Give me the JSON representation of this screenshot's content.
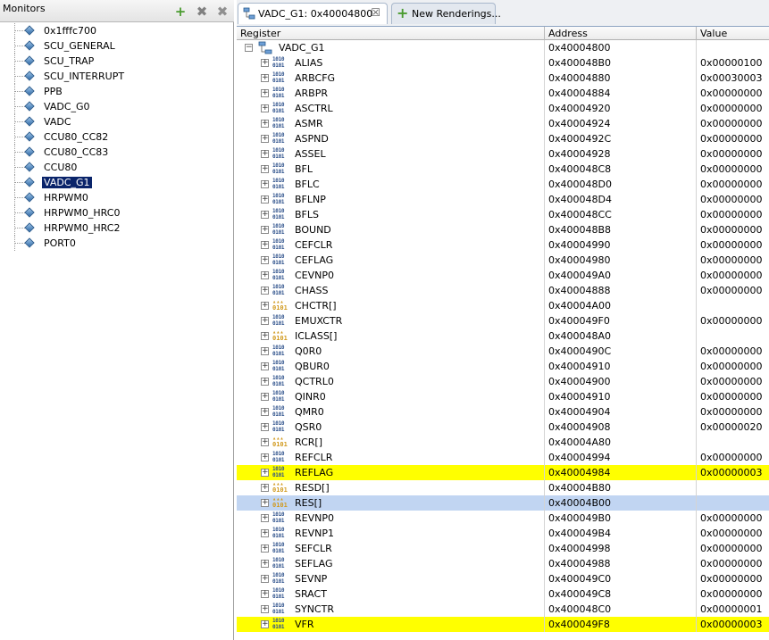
{
  "monitors": {
    "title": "Monitors",
    "add_label": "+",
    "remove_label": "✖",
    "remove_all_label": "✖",
    "items": [
      {
        "label": "0x1fffc700"
      },
      {
        "label": "SCU_GENERAL"
      },
      {
        "label": "SCU_TRAP"
      },
      {
        "label": "SCU_INTERRUPT"
      },
      {
        "label": "PPB"
      },
      {
        "label": "VADC_G0"
      },
      {
        "label": "VADC"
      },
      {
        "label": "CCU80_CC82"
      },
      {
        "label": "CCU80_CC83"
      },
      {
        "label": "CCU80"
      },
      {
        "label": "VADC_G1",
        "selected": true
      },
      {
        "label": "HRPWM0"
      },
      {
        "label": "HRPWM0_HRC0"
      },
      {
        "label": "HRPWM0_HRC2"
      },
      {
        "label": "PORT0"
      }
    ]
  },
  "tabs": [
    {
      "label": "VADC_G1: 0x40004800",
      "close": "☒"
    },
    {
      "label": "New Renderings...",
      "plus": "+"
    }
  ],
  "table": {
    "headers": {
      "register": "Register",
      "address": "Address",
      "value": "Value"
    },
    "root": {
      "name": "VADC_G1",
      "address": "0x40004800",
      "expander": "−"
    },
    "rows": [
      {
        "name": "ALIAS",
        "address": "0x400048B0",
        "value": "0x00000100",
        "icon": "reg"
      },
      {
        "name": "ARBCFG",
        "address": "0x40004880",
        "value": "0x00030003",
        "icon": "reg"
      },
      {
        "name": "ARBPR",
        "address": "0x40004884",
        "value": "0x00000000",
        "icon": "reg"
      },
      {
        "name": "ASCTRL",
        "address": "0x40004920",
        "value": "0x00000000",
        "icon": "reg"
      },
      {
        "name": "ASMR",
        "address": "0x40004924",
        "value": "0x00000000",
        "icon": "reg"
      },
      {
        "name": "ASPND",
        "address": "0x4000492C",
        "value": "0x00000000",
        "icon": "reg"
      },
      {
        "name": "ASSEL",
        "address": "0x40004928",
        "value": "0x00000000",
        "icon": "reg"
      },
      {
        "name": "BFL",
        "address": "0x400048C8",
        "value": "0x00000000",
        "icon": "reg"
      },
      {
        "name": "BFLC",
        "address": "0x400048D0",
        "value": "0x00000000",
        "icon": "reg"
      },
      {
        "name": "BFLNP",
        "address": "0x400048D4",
        "value": "0x00000000",
        "icon": "reg"
      },
      {
        "name": "BFLS",
        "address": "0x400048CC",
        "value": "0x00000000",
        "icon": "reg"
      },
      {
        "name": "BOUND",
        "address": "0x400048B8",
        "value": "0x00000000",
        "icon": "reg"
      },
      {
        "name": "CEFCLR",
        "address": "0x40004990",
        "value": "0x00000000",
        "icon": "reg"
      },
      {
        "name": "CEFLAG",
        "address": "0x40004980",
        "value": "0x00000000",
        "icon": "reg"
      },
      {
        "name": "CEVNP0",
        "address": "0x400049A0",
        "value": "0x00000000",
        "icon": "reg"
      },
      {
        "name": "CHASS",
        "address": "0x40004888",
        "value": "0x00000000",
        "icon": "reg"
      },
      {
        "name": "CHCTR[]",
        "address": "0x40004A00",
        "value": "",
        "icon": "arr"
      },
      {
        "name": "EMUXCTR",
        "address": "0x400049F0",
        "value": "0x00000000",
        "icon": "reg"
      },
      {
        "name": "ICLASS[]",
        "address": "0x400048A0",
        "value": "",
        "icon": "arr"
      },
      {
        "name": "Q0R0",
        "address": "0x4000490C",
        "value": "0x00000000",
        "icon": "reg"
      },
      {
        "name": "QBUR0",
        "address": "0x40004910",
        "value": "0x00000000",
        "icon": "reg"
      },
      {
        "name": "QCTRL0",
        "address": "0x40004900",
        "value": "0x00000000",
        "icon": "reg"
      },
      {
        "name": "QINR0",
        "address": "0x40004910",
        "value": "0x00000000",
        "icon": "reg"
      },
      {
        "name": "QMR0",
        "address": "0x40004904",
        "value": "0x00000000",
        "icon": "reg"
      },
      {
        "name": "QSR0",
        "address": "0x40004908",
        "value": "0x00000020",
        "icon": "reg"
      },
      {
        "name": "RCR[]",
        "address": "0x40004A80",
        "value": "",
        "icon": "arr"
      },
      {
        "name": "REFCLR",
        "address": "0x40004994",
        "value": "0x00000000",
        "icon": "reg"
      },
      {
        "name": "REFLAG",
        "address": "0x40004984",
        "value": "0x00000003",
        "icon": "reg",
        "highlight": "yellow"
      },
      {
        "name": "RESD[]",
        "address": "0x40004B80",
        "value": "",
        "icon": "arr"
      },
      {
        "name": "RES[]",
        "address": "0x40004B00",
        "value": "",
        "icon": "arr",
        "highlight": "selected"
      },
      {
        "name": "REVNP0",
        "address": "0x400049B0",
        "value": "0x00000000",
        "icon": "reg"
      },
      {
        "name": "REVNP1",
        "address": "0x400049B4",
        "value": "0x00000000",
        "icon": "reg"
      },
      {
        "name": "SEFCLR",
        "address": "0x40004998",
        "value": "0x00000000",
        "icon": "reg"
      },
      {
        "name": "SEFLAG",
        "address": "0x40004988",
        "value": "0x00000000",
        "icon": "reg"
      },
      {
        "name": "SEVNP",
        "address": "0x400049C0",
        "value": "0x00000000",
        "icon": "reg"
      },
      {
        "name": "SRACT",
        "address": "0x400049C8",
        "value": "0x00000000",
        "icon": "reg"
      },
      {
        "name": "SYNCTR",
        "address": "0x400048C0",
        "value": "0x00000001",
        "icon": "reg"
      },
      {
        "name": "VFR",
        "address": "0x400049F8",
        "value": "0x00000003",
        "icon": "reg",
        "highlight": "yellow"
      }
    ],
    "expander_collapsed": "+",
    "reg_icon_text": "1010\n0101",
    "arr_icon_text": "▲▲▲\n0101"
  },
  "colors": {
    "highlight_yellow": "#ffff00",
    "selected_row": "#c1d5f2",
    "selected_monitor": "#0a246a"
  }
}
